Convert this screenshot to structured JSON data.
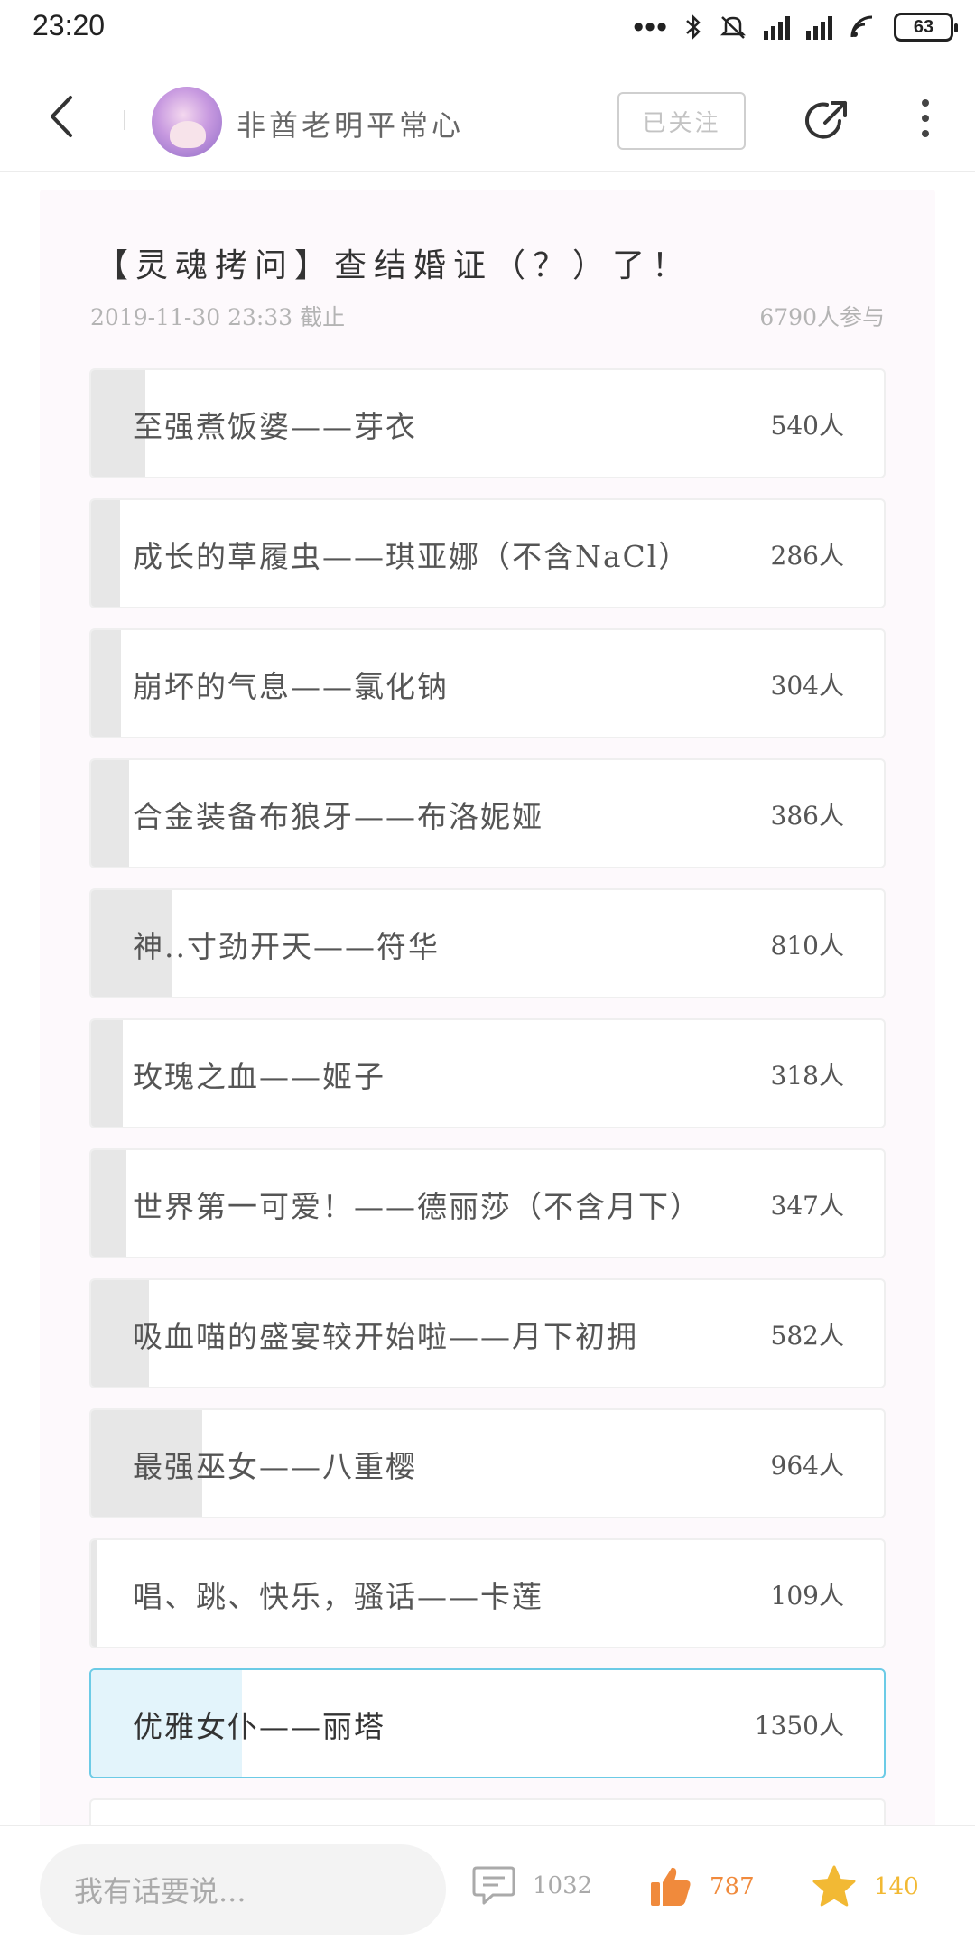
{
  "status_bar": {
    "time": "23:20",
    "battery": "63"
  },
  "header": {
    "username": "非酋老明平常心",
    "follow_label": "已关注"
  },
  "poll": {
    "title": "【灵魂拷问】查结婚证（？）了！",
    "deadline": "2019-11-30 23:33 截止",
    "participants": "6790人参与",
    "options": [
      {
        "label": "至强煮饭婆——芽衣",
        "count": "540人",
        "fill_fraction": 0.068,
        "selected": false
      },
      {
        "label": "成长的草履虫——琪亚娜（不含NaCl）",
        "count": "286人",
        "fill_fraction": 0.036,
        "selected": false
      },
      {
        "label": "崩坏的气息——氯化钠",
        "count": "304人",
        "fill_fraction": 0.038,
        "selected": false
      },
      {
        "label": "合金装备布狼牙——布洛妮娅",
        "count": "386人",
        "fill_fraction": 0.048,
        "selected": false
      },
      {
        "label": "神..寸劲开天——符华",
        "count": "810人",
        "fill_fraction": 0.102,
        "selected": false
      },
      {
        "label": "玫瑰之血——姬子",
        "count": "318人",
        "fill_fraction": 0.04,
        "selected": false
      },
      {
        "label": "世界第一可爱！——德丽莎（不含月下）",
        "count": "347人",
        "fill_fraction": 0.044,
        "selected": false
      },
      {
        "label": "吸血喵的盛宴较开始啦——月下初拥",
        "count": "582人",
        "fill_fraction": 0.073,
        "selected": false
      },
      {
        "label": "最强巫女——八重樱",
        "count": "964人",
        "fill_fraction": 0.14,
        "selected": false
      },
      {
        "label": "唱、跳、快乐，骚话——卡莲",
        "count": "109人",
        "fill_fraction": 0.008,
        "selected": false
      },
      {
        "label": "优雅女仆——丽塔",
        "count": "1350人",
        "fill_fraction": 0.19,
        "selected": true
      }
    ]
  },
  "bottom_bar": {
    "comment_placeholder": "我有话要说...",
    "comments_count": "1032",
    "likes_count": "787",
    "stars_count": "140"
  },
  "colors": {
    "like": "#f08a3c",
    "star": "#f2b934",
    "selected_border": "#6ccbe6"
  },
  "icons": [
    "back-arrow-icon",
    "share-icon",
    "more-vertical-icon",
    "comment-icon",
    "thumbs-up-icon",
    "star-icon"
  ]
}
